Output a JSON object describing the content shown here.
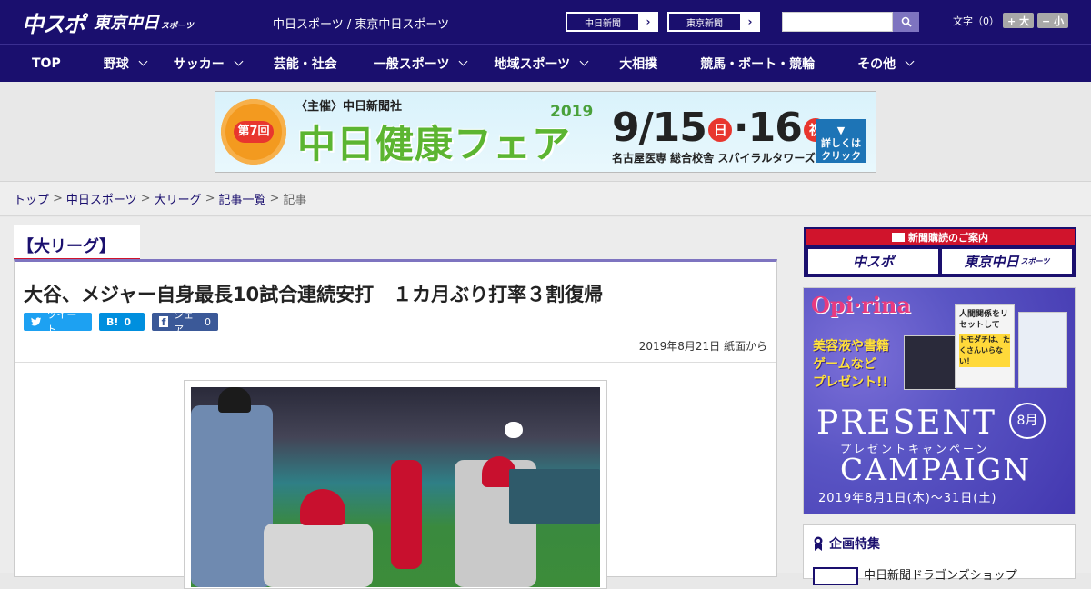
{
  "header": {
    "logo_main": "中スポ",
    "logo_sub": "東京中日",
    "logo_sub_small": "スポーツ",
    "site_caption": "中日スポーツ / 東京中日スポーツ",
    "news_links": [
      {
        "label": "中日新聞"
      },
      {
        "label": "東京新聞"
      }
    ],
    "search_placeholder": "",
    "font_size_label": "文字（0）",
    "font_increase": "+ 大",
    "font_decrease": "− 小"
  },
  "nav": {
    "items": [
      {
        "label": "TOP",
        "has_dropdown": false
      },
      {
        "label": "野球",
        "has_dropdown": true
      },
      {
        "label": "サッカー",
        "has_dropdown": true
      },
      {
        "label": "芸能・社会",
        "has_dropdown": false
      },
      {
        "label": "一般スポーツ",
        "has_dropdown": true
      },
      {
        "label": "地域スポーツ",
        "has_dropdown": true
      },
      {
        "label": "大相撲",
        "has_dropdown": false
      },
      {
        "label": "競馬・ボート・競輪",
        "has_dropdown": false
      },
      {
        "label": "その他",
        "has_dropdown": true
      }
    ]
  },
  "banner": {
    "host": "〈主催〉中日新聞社",
    "edition": "第7回",
    "title": "中日健康フェア",
    "year": "2019",
    "date_start": "9/15",
    "day_start": "日",
    "date_end": "16",
    "day_end": "祝",
    "venue": "名古屋医専 総合校舎 スパイラルタワーズ",
    "cta": "詳しくは クリック"
  },
  "breadcrumb": {
    "items": [
      "トップ",
      "中日スポーツ",
      "大リーグ",
      "記事一覧"
    ],
    "current": "記事",
    "separator": ">"
  },
  "article": {
    "category": "【大リーグ】",
    "headline": "大谷、メジャー自身最長10試合連続安打　１カ月ぶり打率３割復帰",
    "share": {
      "tweet": "ツイート",
      "hatena_count": "0",
      "facebook": "シェア",
      "facebook_count": "0"
    },
    "dateline": "2019年8月21日 紙面から"
  },
  "sidebar": {
    "subscribe_header": "新聞購読のご案内",
    "subscribe_logos": [
      "中スポ",
      "東京中日"
    ],
    "subscribe_logo_small": "スポーツ",
    "ad": {
      "brand": "Opi·rina",
      "copy": [
        "美容液や書籍",
        "ゲームなど",
        "プレゼント!!"
      ],
      "present": "PRESENT",
      "kana": "プレゼントキャンペーン",
      "campaign": "CAMPAIGN",
      "month": "8月",
      "dates": "2019年8月1日(木)〜31日(土)",
      "book_text": [
        "人間関係をリセットして",
        "トモダチは、たくさんいらない！"
      ]
    },
    "feature": {
      "title": "企画特集",
      "item": "中日新聞ドラゴンズショップ"
    }
  },
  "colors": {
    "brand_navy": "#1a0f6e",
    "accent_red": "#d0142c",
    "accent_purple": "#7e74c0",
    "twitter": "#1da1f2",
    "hatena": "#008fde",
    "facebook": "#3b5998"
  }
}
